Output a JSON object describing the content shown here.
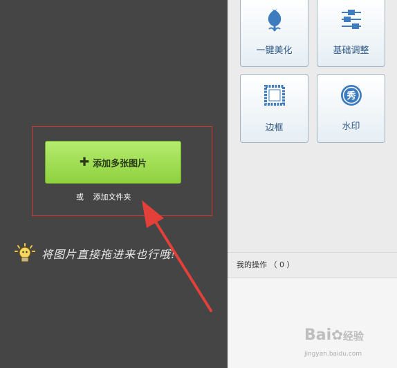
{
  "colors": {
    "left_bg": "#454545",
    "right_bg": "#ebebeb",
    "green_button": "#9bd94d",
    "highlight_red": "#d23b34",
    "tool_label": "#2f5a88",
    "tool_icon": "#3e7cc0"
  },
  "upload": {
    "add_images_label": "添加多张图片",
    "or_label": "或",
    "add_folder_label": "添加文件夹",
    "drag_hint": "将图片直接拖进来也行哦!"
  },
  "tools": [
    {
      "label": "一键美化",
      "icon": "tulip-icon"
    },
    {
      "label": "基础调整",
      "icon": "sliders-icon"
    },
    {
      "label": "边框",
      "icon": "frame-icon"
    },
    {
      "label": "水印",
      "icon": "watermark-seal-icon"
    }
  ],
  "operations": {
    "label": "我的操作",
    "count_text": "（ 0 ）"
  },
  "watermark": {
    "brand": "Bai",
    "brand_cn": "经验",
    "url": "jingyan.baidu.com"
  }
}
